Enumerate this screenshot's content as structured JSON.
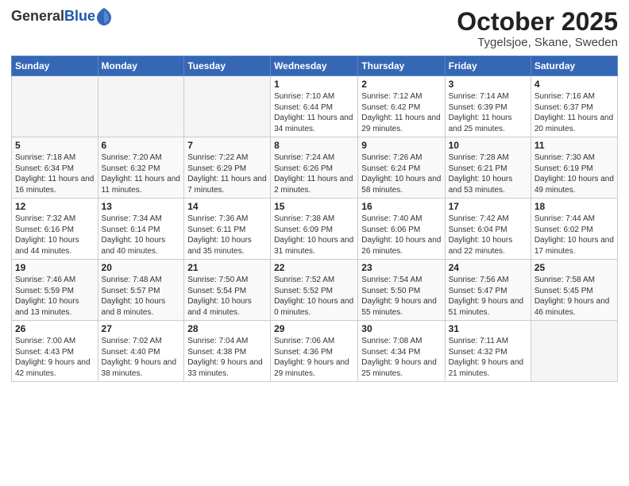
{
  "header": {
    "logo_general": "General",
    "logo_blue": "Blue",
    "month_title": "October 2025",
    "location": "Tygelsjoe, Skane, Sweden"
  },
  "days_of_week": [
    "Sunday",
    "Monday",
    "Tuesday",
    "Wednesday",
    "Thursday",
    "Friday",
    "Saturday"
  ],
  "weeks": [
    [
      {
        "day": "",
        "info": ""
      },
      {
        "day": "",
        "info": ""
      },
      {
        "day": "",
        "info": ""
      },
      {
        "day": "1",
        "info": "Sunrise: 7:10 AM\nSunset: 6:44 PM\nDaylight: 11 hours\nand 34 minutes."
      },
      {
        "day": "2",
        "info": "Sunrise: 7:12 AM\nSunset: 6:42 PM\nDaylight: 11 hours\nand 29 minutes."
      },
      {
        "day": "3",
        "info": "Sunrise: 7:14 AM\nSunset: 6:39 PM\nDaylight: 11 hours\nand 25 minutes."
      },
      {
        "day": "4",
        "info": "Sunrise: 7:16 AM\nSunset: 6:37 PM\nDaylight: 11 hours\nand 20 minutes."
      }
    ],
    [
      {
        "day": "5",
        "info": "Sunrise: 7:18 AM\nSunset: 6:34 PM\nDaylight: 11 hours\nand 16 minutes."
      },
      {
        "day": "6",
        "info": "Sunrise: 7:20 AM\nSunset: 6:32 PM\nDaylight: 11 hours\nand 11 minutes."
      },
      {
        "day": "7",
        "info": "Sunrise: 7:22 AM\nSunset: 6:29 PM\nDaylight: 11 hours\nand 7 minutes."
      },
      {
        "day": "8",
        "info": "Sunrise: 7:24 AM\nSunset: 6:26 PM\nDaylight: 11 hours\nand 2 minutes."
      },
      {
        "day": "9",
        "info": "Sunrise: 7:26 AM\nSunset: 6:24 PM\nDaylight: 10 hours\nand 58 minutes."
      },
      {
        "day": "10",
        "info": "Sunrise: 7:28 AM\nSunset: 6:21 PM\nDaylight: 10 hours\nand 53 minutes."
      },
      {
        "day": "11",
        "info": "Sunrise: 7:30 AM\nSunset: 6:19 PM\nDaylight: 10 hours\nand 49 minutes."
      }
    ],
    [
      {
        "day": "12",
        "info": "Sunrise: 7:32 AM\nSunset: 6:16 PM\nDaylight: 10 hours\nand 44 minutes."
      },
      {
        "day": "13",
        "info": "Sunrise: 7:34 AM\nSunset: 6:14 PM\nDaylight: 10 hours\nand 40 minutes."
      },
      {
        "day": "14",
        "info": "Sunrise: 7:36 AM\nSunset: 6:11 PM\nDaylight: 10 hours\nand 35 minutes."
      },
      {
        "day": "15",
        "info": "Sunrise: 7:38 AM\nSunset: 6:09 PM\nDaylight: 10 hours\nand 31 minutes."
      },
      {
        "day": "16",
        "info": "Sunrise: 7:40 AM\nSunset: 6:06 PM\nDaylight: 10 hours\nand 26 minutes."
      },
      {
        "day": "17",
        "info": "Sunrise: 7:42 AM\nSunset: 6:04 PM\nDaylight: 10 hours\nand 22 minutes."
      },
      {
        "day": "18",
        "info": "Sunrise: 7:44 AM\nSunset: 6:02 PM\nDaylight: 10 hours\nand 17 minutes."
      }
    ],
    [
      {
        "day": "19",
        "info": "Sunrise: 7:46 AM\nSunset: 5:59 PM\nDaylight: 10 hours\nand 13 minutes."
      },
      {
        "day": "20",
        "info": "Sunrise: 7:48 AM\nSunset: 5:57 PM\nDaylight: 10 hours\nand 8 minutes."
      },
      {
        "day": "21",
        "info": "Sunrise: 7:50 AM\nSunset: 5:54 PM\nDaylight: 10 hours\nand 4 minutes."
      },
      {
        "day": "22",
        "info": "Sunrise: 7:52 AM\nSunset: 5:52 PM\nDaylight: 10 hours\nand 0 minutes."
      },
      {
        "day": "23",
        "info": "Sunrise: 7:54 AM\nSunset: 5:50 PM\nDaylight: 9 hours\nand 55 minutes."
      },
      {
        "day": "24",
        "info": "Sunrise: 7:56 AM\nSunset: 5:47 PM\nDaylight: 9 hours\nand 51 minutes."
      },
      {
        "day": "25",
        "info": "Sunrise: 7:58 AM\nSunset: 5:45 PM\nDaylight: 9 hours\nand 46 minutes."
      }
    ],
    [
      {
        "day": "26",
        "info": "Sunrise: 7:00 AM\nSunset: 4:43 PM\nDaylight: 9 hours\nand 42 minutes."
      },
      {
        "day": "27",
        "info": "Sunrise: 7:02 AM\nSunset: 4:40 PM\nDaylight: 9 hours\nand 38 minutes."
      },
      {
        "day": "28",
        "info": "Sunrise: 7:04 AM\nSunset: 4:38 PM\nDaylight: 9 hours\nand 33 minutes."
      },
      {
        "day": "29",
        "info": "Sunrise: 7:06 AM\nSunset: 4:36 PM\nDaylight: 9 hours\nand 29 minutes."
      },
      {
        "day": "30",
        "info": "Sunrise: 7:08 AM\nSunset: 4:34 PM\nDaylight: 9 hours\nand 25 minutes."
      },
      {
        "day": "31",
        "info": "Sunrise: 7:11 AM\nSunset: 4:32 PM\nDaylight: 9 hours\nand 21 minutes."
      },
      {
        "day": "",
        "info": ""
      }
    ]
  ]
}
